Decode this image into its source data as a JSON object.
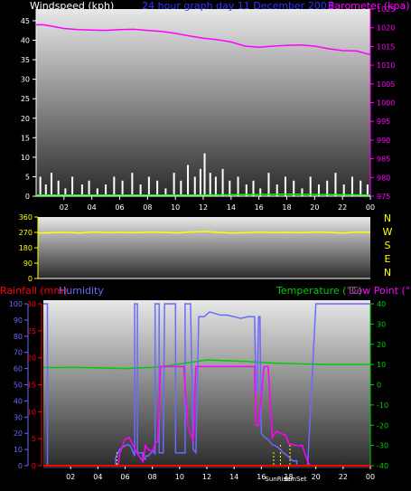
{
  "colors": {
    "background": "#000000",
    "panel_top": "#e8e8e8",
    "panel_bottom": "#2a2a2a",
    "wind_axis": "#ffffff",
    "barometer": "#ff00ff",
    "wind_bars": "#ffffff",
    "wind_avg": "#00ff00",
    "direction": "#ffff00",
    "rain": "#ff0000",
    "humidity": "#6a6aff",
    "temperature": "#00cc00",
    "dewpoint": "#ff00ff",
    "sun": "#ffff00"
  },
  "chart_data": [
    {
      "type": "line",
      "title": "24 hour graph day 11 December 2003",
      "left_label": "Windspeed (kph)",
      "right_label": "Barometer (kpa)",
      "x_ticks": [
        "02",
        "04",
        "06",
        "08",
        "10",
        "12",
        "14",
        "16",
        "18",
        "20",
        "22",
        "00"
      ],
      "left_ticks": [
        "0",
        "5",
        "10",
        "15",
        "20",
        "25",
        "30",
        "35",
        "40",
        "45"
      ],
      "left_range": [
        0,
        48
      ],
      "right_ticks": [
        "975",
        "980",
        "985",
        "990",
        "995",
        "1000",
        "1005",
        "1010",
        "1015",
        "1020",
        "1025"
      ],
      "right_range": [
        975,
        1025
      ],
      "x_range": [
        0,
        24
      ],
      "series": [
        {
          "name": "Barometer",
          "axis": "right",
          "color": "#ff00ff",
          "x": [
            0,
            0.5,
            1,
            2,
            3,
            4,
            5,
            6,
            7,
            8,
            9,
            10,
            11,
            12,
            13,
            14,
            15,
            16,
            17,
            18,
            19,
            20,
            21,
            22,
            23,
            24
          ],
          "values": [
            1020.8,
            1020.8,
            1020.5,
            1019.8,
            1019.5,
            1019.4,
            1019.3,
            1019.5,
            1019.6,
            1019.3,
            1019.0,
            1018.5,
            1017.8,
            1017.2,
            1016.8,
            1016.2,
            1015.1,
            1014.8,
            1015.1,
            1015.3,
            1015.4,
            1015.1,
            1014.4,
            1013.9,
            1013.8,
            1012.8
          ]
        },
        {
          "name": "Wind gust",
          "axis": "left",
          "style": "bars",
          "color": "#ffffff",
          "x": [
            0.3,
            0.7,
            1.1,
            1.6,
            2.1,
            2.6,
            3.3,
            3.8,
            4.4,
            5.0,
            5.6,
            6.2,
            6.9,
            7.5,
            8.1,
            8.7,
            9.3,
            9.9,
            10.4,
            10.9,
            11.4,
            11.8,
            12.1,
            12.5,
            12.9,
            13.4,
            13.9,
            14.5,
            15.1,
            15.6,
            16.1,
            16.7,
            17.3,
            17.9,
            18.5,
            19.1,
            19.7,
            20.3,
            20.9,
            21.5,
            22.1,
            22.7,
            23.3,
            23.8
          ],
          "values": [
            5,
            3,
            6,
            4,
            2,
            5,
            3,
            4,
            2,
            3,
            5,
            4,
            6,
            3,
            5,
            4,
            2,
            6,
            4,
            8,
            5,
            7,
            11,
            6,
            5,
            7,
            4,
            5,
            3,
            4,
            2,
            6,
            3,
            5,
            4,
            2,
            5,
            3,
            4,
            6,
            3,
            5,
            4,
            3
          ]
        },
        {
          "name": "Wind average",
          "axis": "left",
          "color": "#00ff00",
          "x": [
            0,
            12,
            18,
            24
          ],
          "values": [
            0.3,
            0.3,
            0.5,
            0.3
          ]
        }
      ]
    },
    {
      "type": "line",
      "left_ticks": [
        "0",
        "90",
        "180",
        "270",
        "360"
      ],
      "left_range": [
        0,
        360
      ],
      "right_labels": [
        "N",
        "W",
        "S",
        "E",
        "N"
      ],
      "x_range": [
        0,
        24
      ],
      "series": [
        {
          "name": "Wind direction",
          "color": "#ffff00",
          "x": [
            0,
            1,
            2,
            3,
            4,
            5,
            6,
            7,
            8,
            9,
            10,
            11,
            12,
            13,
            14,
            15,
            16,
            17,
            18,
            19,
            20,
            21,
            22,
            23,
            24
          ],
          "values": [
            265,
            268,
            270,
            266,
            272,
            269,
            270,
            268,
            271,
            270,
            267,
            272,
            276,
            270,
            266,
            268,
            271,
            269,
            270,
            268,
            271,
            270,
            266,
            272,
            270
          ]
        }
      ]
    },
    {
      "type": "line",
      "left_labels": [
        "Rainfall (mm)",
        "Humidity"
      ],
      "right_labels": [
        "Temperature (°C)",
        "Dew Point (°C)"
      ],
      "x_ticks": [
        "02",
        "04",
        "06",
        "08",
        "10",
        "12",
        "14",
        "16",
        "18",
        "20",
        "22",
        "00"
      ],
      "rain_ticks": [
        "0",
        "5",
        "10",
        "15",
        "20",
        "25",
        "30"
      ],
      "rain_range": [
        0,
        30
      ],
      "humidity_ticks": [
        "0",
        "10",
        "20",
        "30",
        "40",
        "50",
        "60",
        "70",
        "80",
        "90",
        "100"
      ],
      "humidity_range": [
        0,
        100
      ],
      "temp_ticks": [
        "-40",
        "-30",
        "-20",
        "-10",
        "0",
        "10",
        "20",
        "30",
        "40"
      ],
      "temp_range": [
        -40,
        40
      ],
      "x_range": [
        0,
        24
      ],
      "sun_labels": [
        "SunRise",
        "SunSet"
      ],
      "sun_times": [
        17.4,
        18.1
      ],
      "series": [
        {
          "name": "Rainfall",
          "axis": "rain",
          "color": "#ff0000",
          "x": [
            0,
            24
          ],
          "values": [
            0,
            0
          ]
        },
        {
          "name": "Humidity",
          "axis": "humidity",
          "color": "#6a6aff",
          "x": [
            0,
            0.3,
            0.3,
            5.3,
            5.3,
            5.6,
            5.9,
            6.2,
            6.4,
            6.6,
            6.7,
            6.7,
            6.9,
            6.9,
            7.3,
            7.3,
            7.5,
            7.5,
            7.7,
            7.9,
            8.1,
            8.2,
            8.2,
            8.5,
            8.5,
            8.8,
            8.9,
            9.0,
            9.2,
            9.4,
            9.4,
            9.7,
            9.7,
            10.4,
            10.4,
            10.8,
            11.0,
            11.2,
            11.4,
            11.4,
            11.8,
            12.2,
            12.6,
            13.0,
            13.5,
            14.0,
            14.5,
            15.0,
            15.5,
            15.6,
            15.7,
            15.8,
            15.9,
            16.0,
            16.2,
            16.5,
            16.8,
            17.1,
            17.4,
            17.6,
            17.8,
            18.3,
            18.6,
            18.6,
            19.4,
            20,
            22,
            24
          ],
          "values": [
            100,
            100,
            0,
            0,
            5,
            10,
            12,
            13,
            12,
            8,
            6,
            100,
            100,
            8,
            8,
            4,
            4,
            6,
            6,
            8,
            9,
            7,
            100,
            100,
            8,
            8,
            100,
            100,
            100,
            100,
            100,
            100,
            8,
            8,
            100,
            100,
            10,
            8,
            92,
            92,
            92,
            95,
            94,
            93,
            93,
            92,
            91,
            92,
            92,
            45,
            46,
            92,
            92,
            20,
            18,
            16,
            13,
            12,
            10,
            8,
            7,
            3,
            3,
            0,
            0,
            100,
            100,
            100
          ]
        },
        {
          "name": "Temperature",
          "axis": "temp",
          "color": "#00cc00",
          "x": [
            0,
            1,
            2,
            3,
            4,
            5,
            6,
            7,
            8,
            9,
            10,
            11,
            12,
            13,
            14,
            15,
            16,
            17,
            18,
            19,
            20,
            21,
            22,
            23,
            24
          ],
          "values": [
            8.5,
            8.5,
            8.6,
            8.5,
            8.4,
            8.2,
            8.0,
            8.3,
            8.6,
            9.3,
            10.3,
            11.3,
            12.3,
            12.0,
            11.8,
            11.5,
            11.0,
            10.7,
            10.5,
            10.3,
            10.2,
            10.0,
            10.0,
            10.0,
            10.0
          ]
        },
        {
          "name": "Dew Point",
          "axis": "temp",
          "color": "#ff00ff",
          "x": [
            0,
            5.5,
            5.6,
            6.0,
            6.3,
            6.6,
            6.8,
            7.0,
            7.3,
            7.5,
            7.7,
            8.0,
            8.2,
            8.4,
            8.6,
            9.0,
            9.3,
            9.8,
            10.1,
            10.3,
            10.6,
            11.0,
            11.2,
            11.5,
            12.0,
            13.0,
            14.0,
            15.0,
            15.5,
            15.6,
            15.8,
            16.2,
            16.5,
            16.8,
            17.1,
            17.4,
            17.8,
            18.0,
            18.5,
            19.0,
            19.4,
            19.6,
            24
          ],
          "values": [
            -40,
            -40,
            -34,
            -27,
            -26,
            -30,
            -33,
            -35,
            -38,
            -30,
            -32,
            -33,
            -29,
            -28,
            9,
            9,
            9,
            9,
            9,
            9,
            -20,
            -28,
            9,
            9,
            9,
            9,
            9,
            9,
            9,
            -20,
            -20,
            9,
            9,
            -26,
            -23,
            -24,
            -25,
            -29,
            -30,
            -30,
            -38,
            -40,
            -40
          ]
        }
      ]
    }
  ]
}
